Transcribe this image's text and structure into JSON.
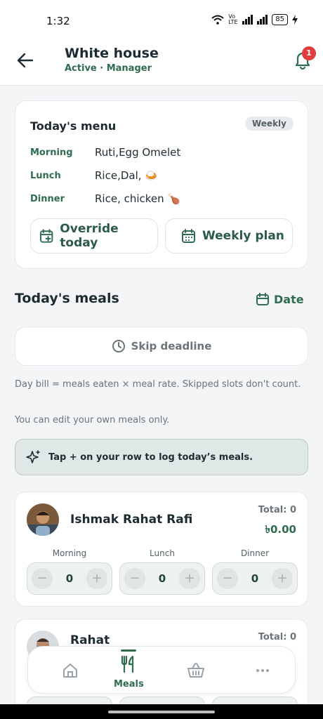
{
  "status": {
    "time": "1:32",
    "battery": "85",
    "network": "Vo LTE"
  },
  "header": {
    "title": "White house",
    "subtitle": "Active · Manager",
    "notification_count": "1"
  },
  "menu": {
    "title": "Today's menu",
    "badge": "Weekly",
    "rows": [
      {
        "slot": "Morning",
        "dish": "Ruti,Egg Omelet"
      },
      {
        "slot": "Lunch",
        "dish": "Rice,Dal, 🍛"
      },
      {
        "slot": "Dinner",
        "dish": "Rice, chicken 🍗"
      }
    ],
    "override_label": "Override today",
    "weekly_plan_label": "Weekly plan"
  },
  "meals": {
    "title": "Today's meals",
    "date_label": "Date",
    "skip_label": "Skip deadline",
    "note_bill": "Day bill = meals eaten × meal rate. Skipped slots don't count.",
    "note_edit": "You can edit your own meals only.",
    "tip": "Tap + on your row to log today’s meals.",
    "members": [
      {
        "name": "Ishmak Rahat Rafi",
        "total_label": "Total: 0",
        "total_amount": "৳0.00",
        "slots": [
          {
            "label": "Morning",
            "value": "0"
          },
          {
            "label": "Lunch",
            "value": "0"
          },
          {
            "label": "Dinner",
            "value": "0"
          }
        ]
      },
      {
        "name": "Rahat",
        "total_label": "Total: 0"
      }
    ]
  },
  "nav": {
    "meals_label": "Meals"
  },
  "colors": {
    "accent": "#2f6b4f",
    "badge": "#e13d3d",
    "tip_bg": "#dfe8e6"
  }
}
